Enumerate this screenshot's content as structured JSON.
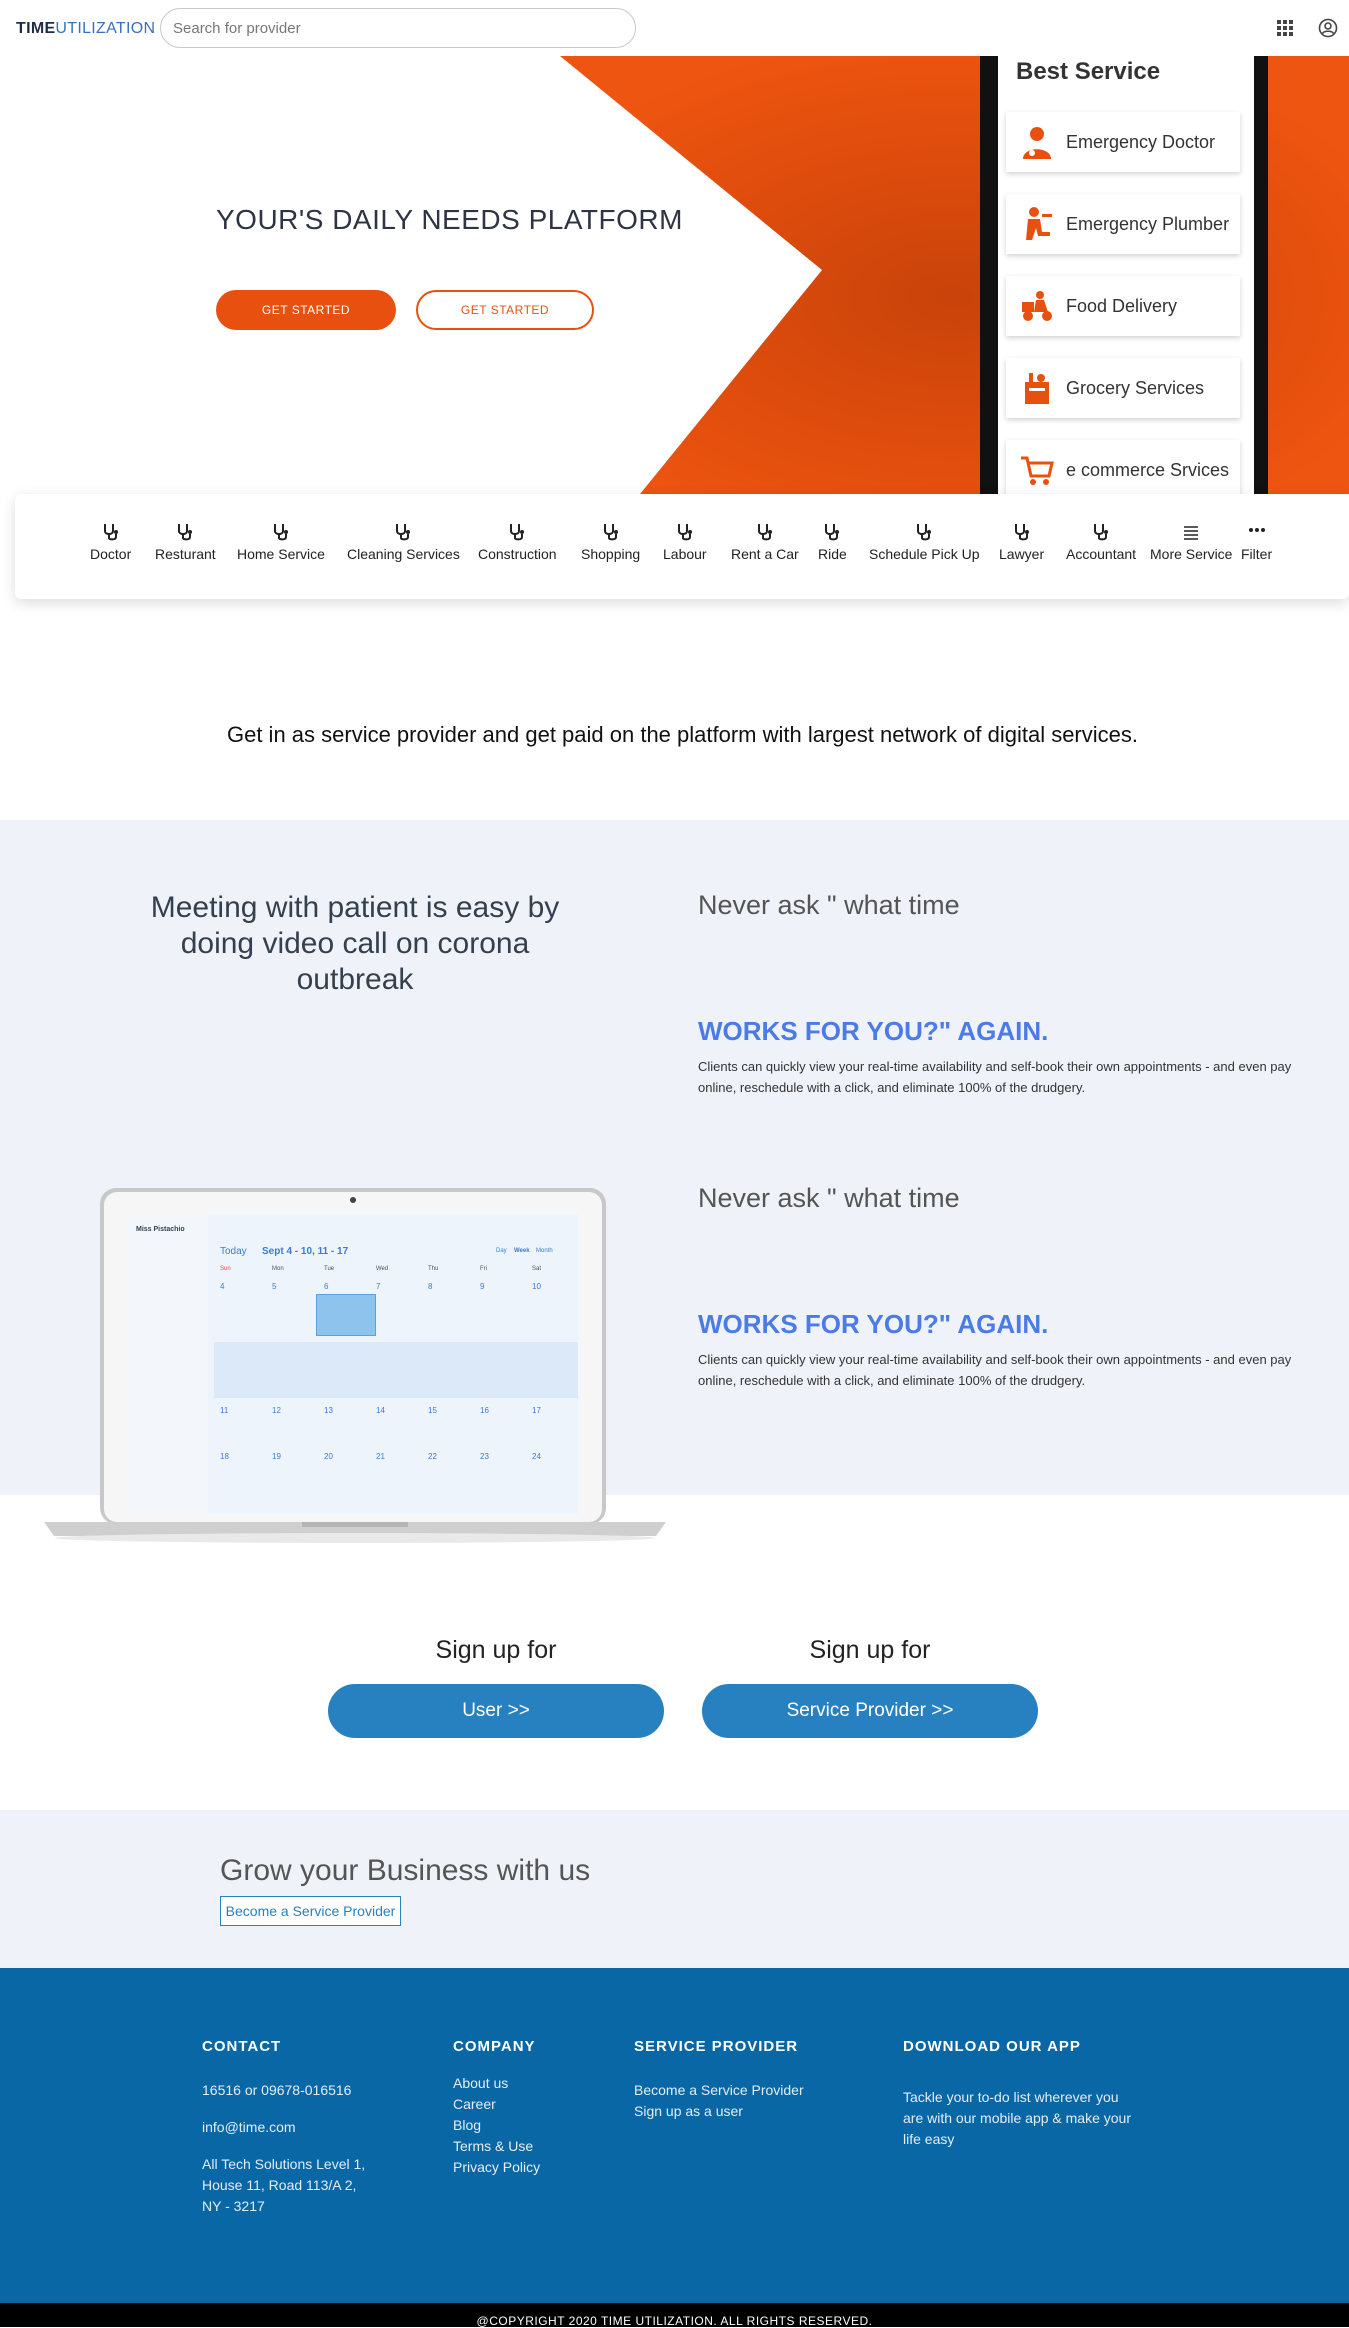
{
  "header": {
    "logo_bold": "TIME",
    "logo_light": "UTILIZATION",
    "search_placeholder": "Search for provider",
    "icons": [
      "apps-grid-icon",
      "account-circle-icon"
    ]
  },
  "hero": {
    "title": "YOUR'S DAILY NEEDS PLATFORM",
    "primary_button": "GET STARTED",
    "secondary_button": "GET STARTED",
    "accent_color": "#e8500f"
  },
  "best_service": {
    "title": "Best Service",
    "items": [
      {
        "label": "Emergency Doctor",
        "icon": "doctor-icon"
      },
      {
        "label": "Emergency Plumber",
        "icon": "plumber-icon"
      },
      {
        "label": "Food Delivery",
        "icon": "delivery-scooter-icon"
      },
      {
        "label": "Grocery Services",
        "icon": "grocery-bag-icon"
      },
      {
        "label": "e commerce Srvices",
        "icon": "shopping-cart-icon"
      }
    ]
  },
  "categories": [
    {
      "label": "Doctor",
      "icon": "stethoscope-icon"
    },
    {
      "label": "Resturant",
      "icon": "stethoscope-icon"
    },
    {
      "label": "Home Service",
      "icon": "stethoscope-icon"
    },
    {
      "label": "Cleaning Services",
      "icon": "stethoscope-icon"
    },
    {
      "label": "Construction",
      "icon": "stethoscope-icon"
    },
    {
      "label": "Shopping",
      "icon": "stethoscope-icon"
    },
    {
      "label": "Labour",
      "icon": "stethoscope-icon"
    },
    {
      "label": "Rent a Car",
      "icon": "stethoscope-icon"
    },
    {
      "label": "Ride",
      "icon": "stethoscope-icon"
    },
    {
      "label": "Schedule Pick Up",
      "icon": "stethoscope-icon"
    },
    {
      "label": "Lawyer",
      "icon": "stethoscope-icon"
    },
    {
      "label": "Accountant",
      "icon": "stethoscope-icon"
    },
    {
      "label": "More Service",
      "icon": "list-icon"
    },
    {
      "label": "Filter",
      "icon": "more-dots-icon"
    }
  ],
  "tagline": "Get in as service provider and get paid on the platform with largest network of digital services.",
  "features": {
    "left_heading": "Meeting with patient is easy by doing video call on corona outbreak",
    "blocks": [
      {
        "lead": "Never ask \" what time",
        "headline": "WORKS FOR YOU?\" AGAIN.",
        "description": "Clients can quickly view your real-time availability and self-book their own appointments - and even pay online, reschedule with a click, and eliminate 100% of the drudgery."
      },
      {
        "lead": "Never ask \" what time",
        "headline": "WORKS FOR YOU?\" AGAIN.",
        "description": "Clients can quickly view your real-time availability and self-book their own appointments - and even pay online, reschedule with a click, and eliminate 100% of the drudgery."
      }
    ],
    "laptop_screen": {
      "name": "Miss Pistachio",
      "today": "Today",
      "range": "Sept 4 - 10, 11 - 17",
      "views": [
        "Day",
        "Week",
        "Month"
      ],
      "weekdays": [
        "Sun",
        "Mon",
        "Tue",
        "Wed",
        "Thu",
        "Fri",
        "Sat"
      ],
      "week1": [
        "4",
        "5",
        "6",
        "7",
        "8",
        "9",
        "10"
      ],
      "week2": [
        "11",
        "12",
        "13",
        "14",
        "15",
        "16",
        "17"
      ],
      "week3": [
        "18",
        "19",
        "20",
        "21",
        "22",
        "23",
        "24"
      ]
    }
  },
  "signup": {
    "user_label": "Sign up for",
    "user_button": "User >>",
    "provider_label": "Sign up for",
    "provider_button": "Service Provider >>",
    "button_color": "#2781c1"
  },
  "grow": {
    "title": "Grow your Business with us",
    "button": "Become a Service Provider"
  },
  "footer": {
    "contact": {
      "heading": "CONTACT",
      "phone": "16516 or 09678-016516",
      "email": "info@time.com",
      "address_line1": "All Tech Solutions Level 1,",
      "address_line2": "House 11, Road 113/A 2,",
      "address_line3": "NY - 3217"
    },
    "company": {
      "heading": "COMPANY",
      "links": [
        "About us",
        "Career",
        "Blog",
        "Terms & Use",
        "Privacy Policy"
      ]
    },
    "service_provider": {
      "heading": "SERVICE PROVIDER",
      "links": [
        "Become a Service Provider",
        "Sign up as a user"
      ]
    },
    "download": {
      "heading": "DOWNLOAD OUR APP",
      "line1": "Tackle your to-do list wherever you",
      "line2": "are with our mobile app & make your",
      "line3": "life easy"
    },
    "background": "#0967a5"
  },
  "copyright": "@COPYRIGHT 2020 TIME UTILIZATION. ALL RIGHTS RESERVED."
}
